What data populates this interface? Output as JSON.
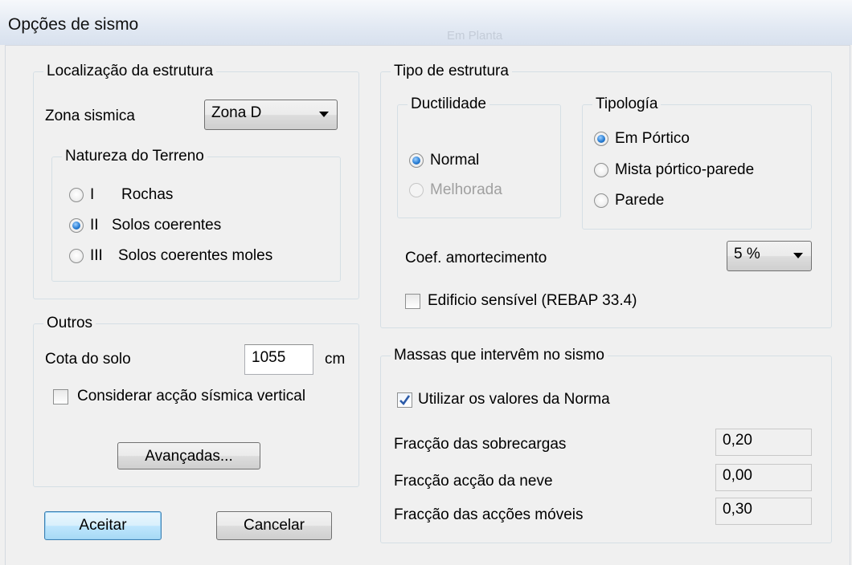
{
  "window": {
    "title": "Opções de sismo",
    "background_hint_1": "...",
    "background_hint_2": "Em Planta"
  },
  "location": {
    "legend": "Localização da estrutura",
    "zone_label": "Zona sismica",
    "zone_value": "Zona D",
    "soil": {
      "legend": "Natureza do Terreno",
      "options": [
        {
          "numeral": "I",
          "label": "Rochas",
          "checked": false
        },
        {
          "numeral": "II",
          "label": "Solos coerentes",
          "checked": true
        },
        {
          "numeral": "III",
          "label": "Solos coerentes moles",
          "checked": false
        }
      ]
    }
  },
  "others": {
    "legend": "Outros",
    "ground_label": "Cota do solo",
    "ground_value": "1055",
    "ground_unit": "cm",
    "vertical_label": "Considerar acção sísmica vertical",
    "vertical_checked": false,
    "advanced_button": "Avançadas..."
  },
  "structure": {
    "legend": "Tipo de estrutura",
    "ductility": {
      "legend": "Ductilidade",
      "options": [
        {
          "label": "Normal",
          "checked": true,
          "enabled": true
        },
        {
          "label": "Melhorada",
          "checked": false,
          "enabled": false
        }
      ]
    },
    "typology": {
      "legend": "Tipología",
      "options": [
        {
          "label": "Em Pórtico",
          "checked": true
        },
        {
          "label": "Mista pórtico-parede",
          "checked": false
        },
        {
          "label": "Parede",
          "checked": false
        }
      ]
    },
    "damping_label": "Coef. amortecimento",
    "damping_value": "5 %",
    "sensitive_label": "Edificio sensível (REBAP 33.4)",
    "sensitive_checked": false
  },
  "masses": {
    "legend": "Massas que intervêm no sismo",
    "use_norm_label": "Utilizar os valores da Norma",
    "use_norm_checked": true,
    "rows": [
      {
        "label": "Fracção das sobrecargas",
        "value": "0,20"
      },
      {
        "label": "Fracção acção da neve",
        "value": "0,00"
      },
      {
        "label": "Fracção das acções móveis",
        "value": "0,30"
      }
    ]
  },
  "buttons": {
    "accept": "Aceitar",
    "cancel": "Cancelar"
  },
  "colors": {
    "accent_radio": "#2a7fd5",
    "check_mark": "#2b5aa8",
    "default_button_border": "#3c7fb1"
  }
}
